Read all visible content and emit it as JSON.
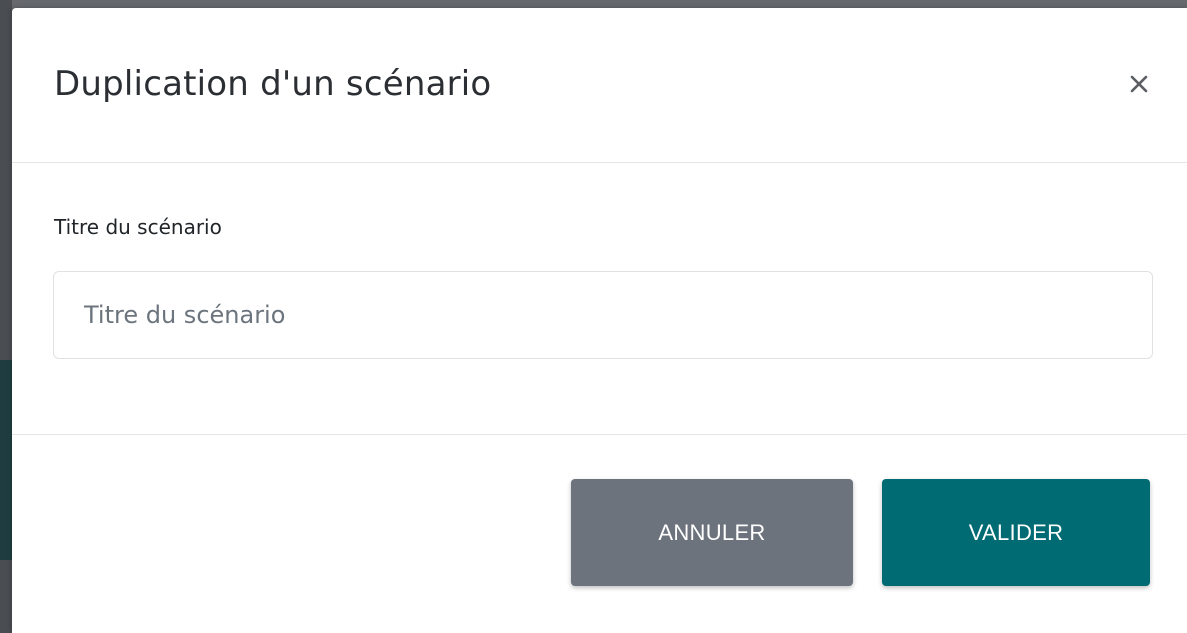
{
  "dialog": {
    "title": "Duplication d'un scénario",
    "close_icon": "close-icon"
  },
  "form": {
    "title_label": "Titre du scénario",
    "title_value": "",
    "title_placeholder": "Titre du scénario"
  },
  "footer": {
    "cancel_label": "ANNULER",
    "confirm_label": "VALIDER"
  },
  "colors": {
    "cancel_button": "#6c737d",
    "confirm_button": "#006b73",
    "overlay": "#66696e"
  }
}
